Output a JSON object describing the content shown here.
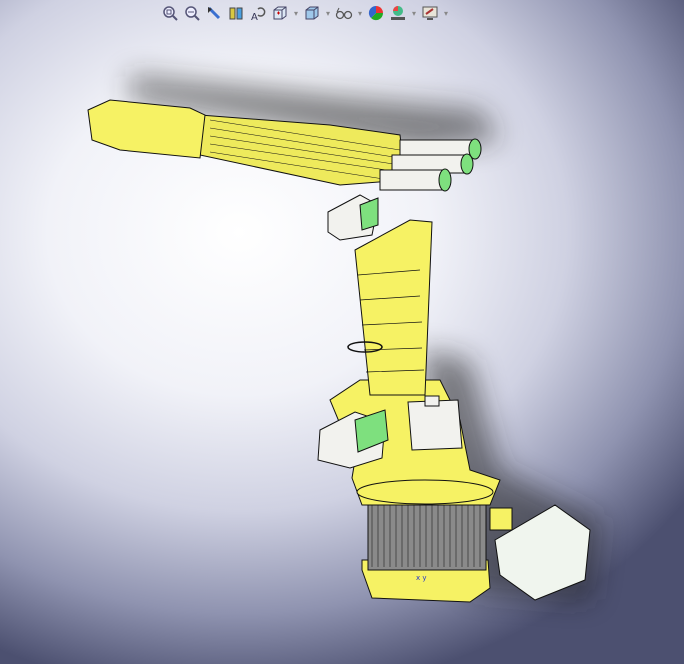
{
  "toolbar": {
    "items": [
      {
        "icon": "zoom-to-fit-icon"
      },
      {
        "icon": "zoom-to-area-icon"
      },
      {
        "icon": "previous-view-icon"
      },
      {
        "icon": "section-view-icon"
      },
      {
        "icon": "dynamic-annotation-views-icon"
      },
      {
        "icon": "view-orientation-icon",
        "dropdown": true
      },
      {
        "icon": "display-style-icon",
        "dropdown": true
      },
      {
        "icon": "hide-show-items-icon",
        "dropdown": true
      },
      {
        "icon": "edit-appearance-icon"
      },
      {
        "icon": "apply-scene-icon",
        "dropdown": true
      },
      {
        "icon": "view-settings-icon",
        "dropdown": true
      }
    ],
    "dropdown_glyph": "▾"
  },
  "model": {
    "body_color": "#f6f264",
    "motor_color": "#f2f2ee",
    "motor_cap_color": "#7ee07e",
    "outline_color": "#111111",
    "triad_color": "#2233cc"
  }
}
